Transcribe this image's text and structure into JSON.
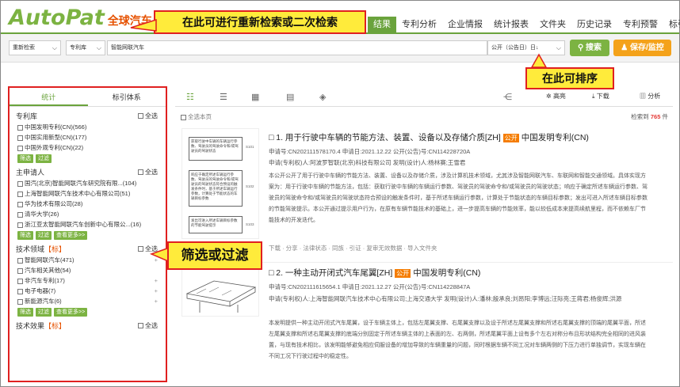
{
  "header": {
    "logo_main": "AutoPat",
    "logo_sub": "全球汽车",
    "nav": [
      "结果",
      "专利分析",
      "企业情报",
      "统计报表",
      "文件夹",
      "历史记录",
      "专利预警",
      "标引管理"
    ]
  },
  "search": {
    "mode": "重新检索",
    "db": "专利库",
    "query": "智能网联汽车",
    "sort": "公开（公告日）日↓",
    "search_btn": "搜索",
    "save_btn": "保存/监控"
  },
  "callouts": {
    "top": "在此可进行重新检索或二次检索",
    "sort": "在此可排序",
    "filter": "筛选或过滤"
  },
  "left_panel": {
    "tabs": [
      "统计",
      "标引体系"
    ],
    "select_all": "全选",
    "sections": [
      {
        "title": "专利库",
        "highlight": "",
        "options": [
          "中国发明专利(CN)(566)",
          "中国实用新型(CN)(177)",
          "中国外观专利(CN)(22)"
        ],
        "pills": [
          "筛选",
          "过滤"
        ]
      },
      {
        "title": "主申请人",
        "highlight": "",
        "options": [
          "国汽(北京)智能网联汽车研究院有限...(104)",
          "上海智能网联汽车技术中心有限公司(51)",
          "华为技术有限公司(28)",
          "清华大学(26)",
          "浙江亚太智能网联汽车创新中心有限公...(16)"
        ],
        "pills": [
          "筛选",
          "过滤",
          "查看更多>>"
        ]
      },
      {
        "title": "技术领域",
        "highlight": "【标】",
        "options": [
          "智能网联汽车(471)",
          "汽车相关其他(54)",
          "非汽车专利(17)",
          "电子电器(7)",
          "新能源汽车(6)"
        ],
        "pills": [
          "筛选",
          "过滤",
          "查看更多>>"
        ]
      },
      {
        "title": "技术效果",
        "highlight": "【标】",
        "options": [],
        "pills": []
      }
    ]
  },
  "toolbar": {
    "highlight": "高亮",
    "download": "下载",
    "analyze": "分析",
    "select_page": "全选本页",
    "hit_prefix": "检索到",
    "hit_count": "765",
    "hit_suffix": "件"
  },
  "results": [
    {
      "title": "□ 1. 用于行驶中车辆的节能方法、装置、设备以及存储介质[ZH]",
      "badge": "公开",
      "type": "中国发明专利(CN)",
      "meta1": "申请号:CN202111578170.4    申请日:2021.12.22    公开(公告)号:CN114228720A",
      "meta2": "申请(专利权)人:阿波罗智联(北京)科技有限公司    发明(设计)人:杨林赛;王雪君",
      "abstract": "本公开公开了用于行驶中车辆的节能方法、装置、设备以及存储介质，涉及计算机技术领域，尤其涉及智能网联汽车、车联网和智能交通领域。具体实现方案为：用于行驶中车辆的节能方法，包括：获取行驶中车辆的车辆运行参数、驾驶员的驾驶命令和/或驾驶员的驾驶状态；响应于确定所述车辆运行参数、驾驶员的驾驶命令和/或驾驶员的驾驶状态符合预设的触发条件时，基于所述车辆运行参数，计算处于节能状态的车辆目标参数；发出可进入所述车辆目标参数的节能驾驶提示。本公开通过提示用户行为，在原有车辆节能技术的基础上，进一步提高车辆的节能效率，能以较低成本来提高续航里程，而不依赖车厂节能技术的开发迭代。",
      "actions": "下载 · 分享 · 法律状态 · 同族 · 引证 · 复审无效数据 · 导入文件夹",
      "flow": [
        "获取行驶中车辆的车辆运行参数、驾驶员的驾驶命令和/或驾驶员的驾驶状态",
        "响应于确定所述车辆运行参数、驾驶员的驾驶命令和/或驾驶员的驾驶状态符合预设的触发条件时，基于所述车辆运行参数，计算处于节能状态的车辆目标参数",
        "发出可进入所述车辆目标参数的节能驾驶提示"
      ],
      "flow_tags": [
        "S101",
        "S102",
        "S103"
      ]
    },
    {
      "title": "□ 2. 一种主动开闭式汽车尾翼[ZH]",
      "badge": "公开",
      "type": "中国发明专利(CN)",
      "meta1": "申请号:CN202111615654.1    申请日:2021.12.27    公开(公告)号:CN114228847A",
      "meta2": "申请(专利权)人:上海智能网联汽车技术中心有限公司;上海交通大学    发明(设计)人:潘林;殷承良;刘昂阳;李博远;汪际亮;王蒋君;杨俊辉;洪源",
      "abstract": "本发明提供一种主动开闭式汽车尾翼，设于车辆主体上，包括左尾翼支撑、右尾翼支撑以及设于所述左尾翼支撑和所述右尾翼支撑的顶端的尾翼平面，所述左尾翼支撑和所述右尾翼支撑的底端分别固定于所述车辆主体的上表面的左、右两侧，所述尾翼平面上设有多个左右对称分布且形状结构完全相同的进风装置，与现有技术相比，该发明能够避免相应伺服设备的增加导致的车辆重量的问题，同时根据车辆不同工况对车辆两侧的下压力进行单独调节，实现车辆在不同工况下行驶过程中的稳定性。"
    }
  ]
}
